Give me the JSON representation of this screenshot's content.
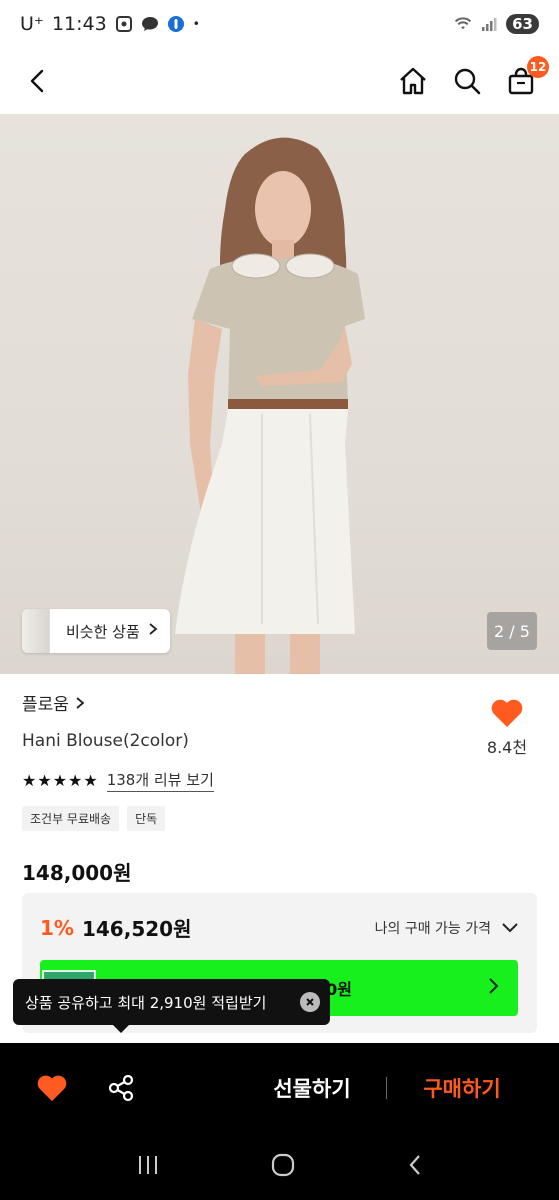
{
  "status_bar": {
    "carrier": "U⁺",
    "time": "11:43",
    "battery": "63"
  },
  "nav": {
    "cart_count": "12"
  },
  "image": {
    "similar_label": "비슷한 상품",
    "counter": "2 / 5"
  },
  "product": {
    "brand": "플로움",
    "name": "Hani Blouse(2color)",
    "rating_stars": "★★★★★",
    "review_link": "138개 리뷰 보기",
    "tags": [
      "조건부 무료배송",
      "단독"
    ],
    "price": "148,000원",
    "like_count": "8.4천"
  },
  "my_price": {
    "discount": "1%",
    "value": "146,520원",
    "label": "나의 구매 가능 가격",
    "coupon_text_visible": "0원"
  },
  "tooltip": {
    "text": "상품 공유하고 최대 2,910원 적립받기"
  },
  "action_bar": {
    "gift_label": "선물하기",
    "buy_label": "구매하기"
  },
  "colors": {
    "accent": "#ff5a1f",
    "coupon_green": "#18f01d"
  }
}
